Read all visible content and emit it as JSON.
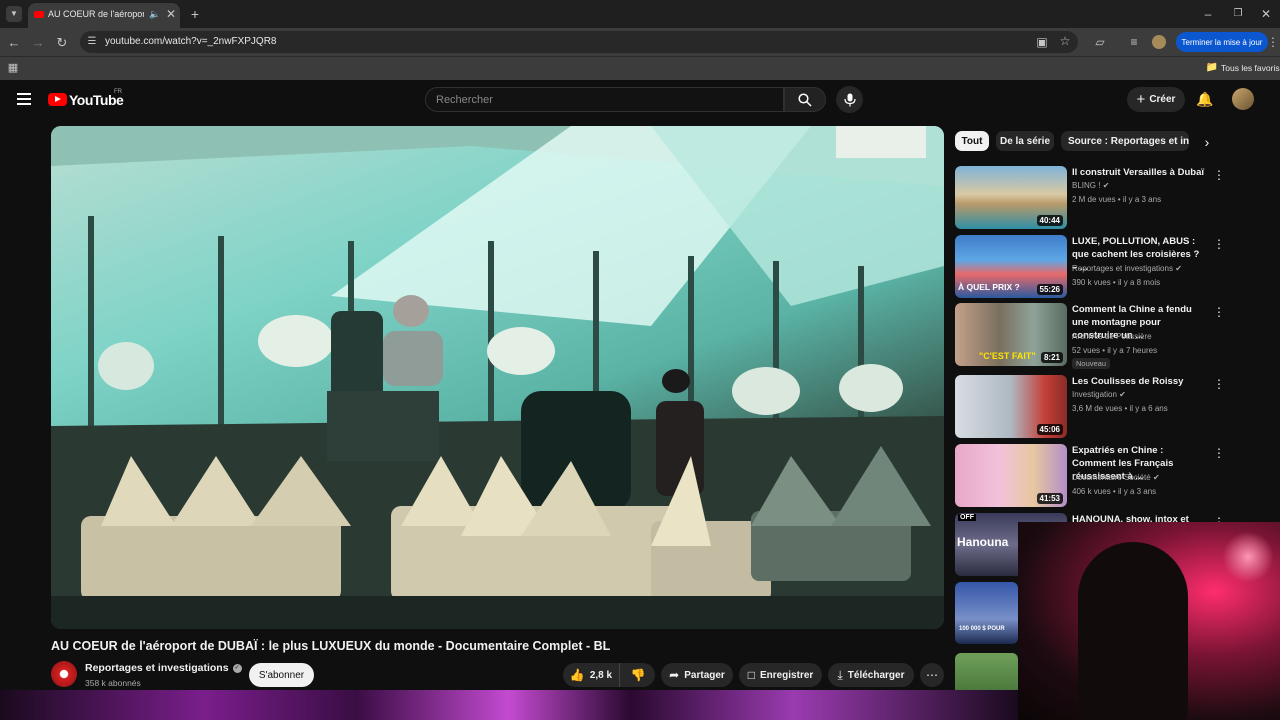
{
  "browser": {
    "tab_title": "AU COEUR de l'aéroport de",
    "url": "youtube.com/watch?v=_2nwFXPJQR8",
    "update_button": "Terminer la mise à jour",
    "bookmarks_label": "Tous les favoris"
  },
  "youtube": {
    "logo": "YouTube",
    "country": "FR",
    "search_placeholder": "Rechercher",
    "create_label": "Créer",
    "chips": [
      "Tout",
      "De la série",
      "Source : Reportages et inves"
    ],
    "video": {
      "title": "AU COEUR de l'aéroport de DUBAÏ : le plus LUXUEUX du monde - Documentaire Complet - BL",
      "channel": "Reportages et investigations",
      "subscribers": "358 k abonnés",
      "subscribe_label": "S'abonner",
      "likes": "2,8 k",
      "share_label": "Partager",
      "save_label": "Enregistrer",
      "download_label": "Télécharger"
    },
    "recommendations": [
      {
        "title": "Il construit Versailles à Dubaï",
        "channel": "BLING !",
        "verified": true,
        "meta": "2 M de vues • il y a 3 ans",
        "duration": "40:44",
        "badge": ""
      },
      {
        "title": "LUXE, POLLUTION, ABUS : que cachent les croisières ? – ...",
        "channel": "Reportages et investigations",
        "verified": true,
        "meta": "390 k vues • il y a 8 mois",
        "duration": "55:26",
        "badge": ""
      },
      {
        "title": "Comment la Chine a fendu une montagne pour construire un ...",
        "channel": "Archives de Poussière",
        "verified": false,
        "meta": "52 vues • il y a 7 heures",
        "duration": "8:21",
        "badge": "Nouveau"
      },
      {
        "title": "Les Coulisses de Roissy",
        "channel": "Investigation",
        "verified": true,
        "meta": "3,6 M de vues • il y a 6 ans",
        "duration": "45:06",
        "badge": ""
      },
      {
        "title": "Expatriés en Chine : Comment les Français réussissent à ...",
        "channel": "Documentaire Société",
        "verified": true,
        "meta": "406 k vues • il y a 3 ans",
        "duration": "41:53",
        "badge": ""
      },
      {
        "title": "HANOUNA, show, intox et",
        "channel": "",
        "verified": false,
        "meta": "",
        "duration": "",
        "badge": ""
      }
    ],
    "thumb_texts": {
      "cruise": "À QUEL PRIX ?",
      "china": "\"C'EST FAIT\"",
      "hanouna": "Hanouna",
      "off": "OFF",
      "pour": "100 000 $ POUR"
    }
  }
}
